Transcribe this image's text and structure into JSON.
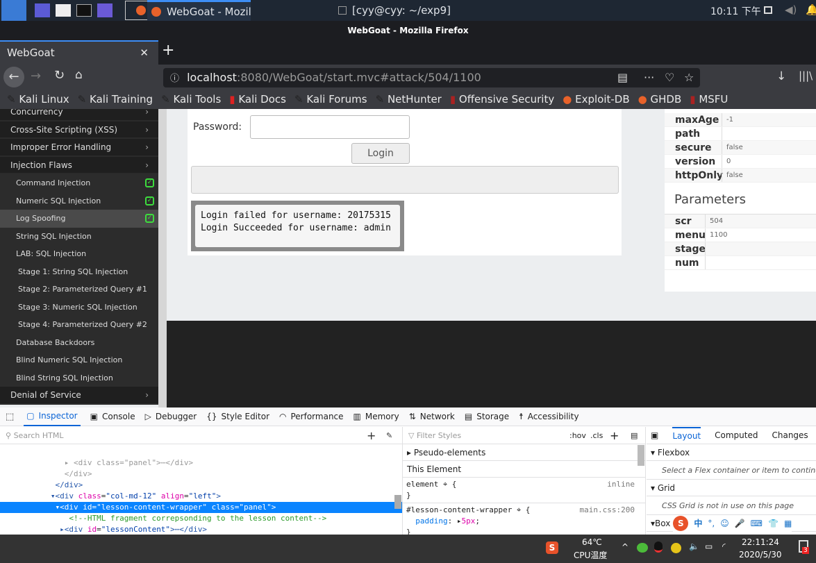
{
  "os_panel": {
    "active_window": "WebGoat - Mozilla Firef...",
    "terminal_window": "[cyy@cyy: ~/exp9]",
    "clock": "10:11 下午"
  },
  "browser": {
    "window_title": "WebGoat - Mozilla Firefox",
    "tab_title": "WebGoat",
    "url_host": "localhost",
    "url_rest": ":8080/WebGoat/start.mvc#attack/504/1100",
    "bookmarks": [
      "Kali Linux",
      "Kali Training",
      "Kali Tools",
      "Kali Docs",
      "Kali Forums",
      "NetHunter",
      "Offensive Security",
      "Exploit-DB",
      "GHDB",
      "MSFU"
    ]
  },
  "sidebar": {
    "items": [
      {
        "label": "Concurrency",
        "type": "cat"
      },
      {
        "label": "Cross-Site Scripting (XSS)",
        "type": "cat"
      },
      {
        "label": "Improper Error Handling",
        "type": "cat"
      },
      {
        "label": "Injection Flaws",
        "type": "cat"
      },
      {
        "label": "Command Injection",
        "type": "sub",
        "done": true
      },
      {
        "label": "Numeric SQL Injection",
        "type": "sub",
        "done": true
      },
      {
        "label": "Log Spoofing",
        "type": "sub",
        "done": true,
        "selected": true
      },
      {
        "label": "String SQL Injection",
        "type": "sub"
      },
      {
        "label": "LAB: SQL Injection",
        "type": "sub"
      },
      {
        "label": "Stage 1: String SQL Injection",
        "type": "stage"
      },
      {
        "label": "Stage 2: Parameterized Query #1",
        "type": "stage"
      },
      {
        "label": "Stage 3: Numeric SQL Injection",
        "type": "stage"
      },
      {
        "label": "Stage 4: Parameterized Query #2",
        "type": "stage"
      },
      {
        "label": "Database Backdoors",
        "type": "sub"
      },
      {
        "label": "Blind Numeric SQL Injection",
        "type": "sub"
      },
      {
        "label": "Blind String SQL Injection",
        "type": "sub"
      },
      {
        "label": "Denial of Service",
        "type": "cat"
      }
    ]
  },
  "lesson": {
    "password_label": "Password:",
    "password_value": "",
    "login_button": "Login",
    "log_lines": [
      "Login failed for username: 20175315",
      "Login Succeeded for username: admin"
    ]
  },
  "cookie": [
    {
      "k": "maxAge",
      "v": "-1"
    },
    {
      "k": "path",
      "v": ""
    },
    {
      "k": "secure",
      "v": "false"
    },
    {
      "k": "version",
      "v": "0"
    },
    {
      "k": "httpOnly",
      "v": "false"
    }
  ],
  "parameters_title": "Parameters",
  "parameters": [
    {
      "k": "scr",
      "v": "504"
    },
    {
      "k": "menu",
      "v": "1100"
    },
    {
      "k": "stage",
      "v": ""
    },
    {
      "k": "num",
      "v": ""
    }
  ],
  "devtools": {
    "tabs": [
      "Inspector",
      "Console",
      "Debugger",
      "Style Editor",
      "Performance",
      "Memory",
      "Network",
      "Storage",
      "Accessibility"
    ],
    "search_html": "Search HTML",
    "filter_styles": "Filter Styles",
    "hov": ":hov",
    "cls": ".cls",
    "pseudo": "Pseudo-elements",
    "this_element": "This Element",
    "rule1_sel": "element",
    "rule1_src": "inline",
    "rule2_sel": "#lesson-content-wrapper",
    "rule2_src": "main.css:200",
    "rule2_prop": "padding",
    "rule2_val": "5px",
    "layout_tabs": [
      "Layout",
      "Computed",
      "Changes"
    ],
    "flexbox": "Flexbox",
    "flex_msg": "Select a Flex container or item to continue",
    "grid": "Grid",
    "grid_msg": "CSS Grid is not in use on this page",
    "box": "Box"
  },
  "taskbar": {
    "temp": "64℃",
    "temp_label": "CPU温度",
    "time": "22:11:24",
    "date": "2020/5/30",
    "notif_count": "3",
    "ime": "中"
  }
}
